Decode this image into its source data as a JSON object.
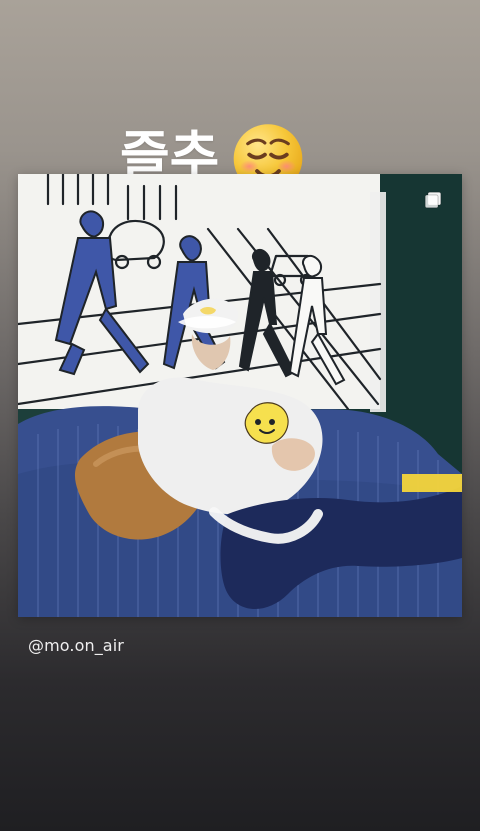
{
  "story": {
    "caption_text": "즐추",
    "caption_emoji": "smiling-face-emoji",
    "post_author_handle": "@mo.on_air",
    "icons": {
      "carousel": "multiple-photos-icon"
    },
    "colors": {
      "gradient_top": "#a9a299",
      "gradient_bottom": "#1f1f22"
    }
  }
}
